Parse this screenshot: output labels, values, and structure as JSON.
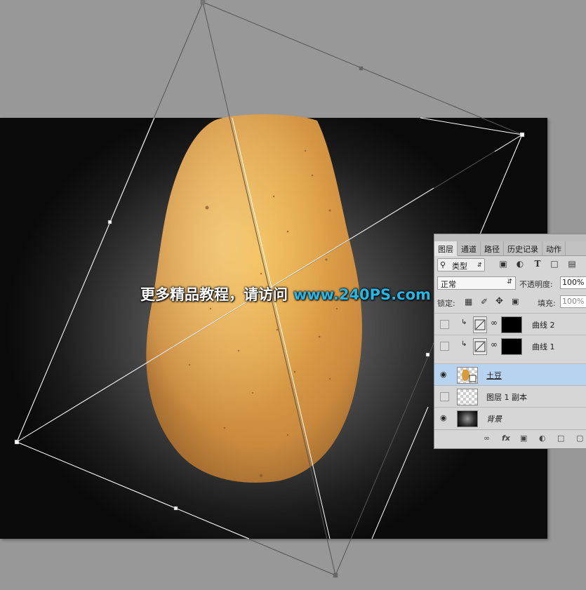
{
  "watermark": {
    "text_cn": "更多精品教程，请访问",
    "url": "www.240PS.com",
    "url_color": "#22b8e8"
  },
  "layers_panel": {
    "tabs": [
      {
        "label": "图层",
        "active": true
      },
      {
        "label": "通道",
        "active": false
      },
      {
        "label": "路径",
        "active": false
      },
      {
        "label": "历史记录",
        "active": false
      },
      {
        "label": "动作",
        "active": false
      }
    ],
    "filter": {
      "label": "类型",
      "icons": [
        "image-filter-icon",
        "adjustment-filter-icon",
        "type-filter-icon",
        "shape-filter-icon",
        "smart-object-filter-icon"
      ]
    },
    "blend_mode": "正常",
    "opacity_label": "不透明度:",
    "opacity_value": "100%",
    "lock_label": "锁定:",
    "fill_label": "填充:",
    "fill_value": "100%",
    "layers": [
      {
        "name": "曲线 2",
        "visible": false,
        "type": "curves-adjustment",
        "clipped": true,
        "selected": false
      },
      {
        "name": "曲线 1",
        "visible": false,
        "type": "curves-adjustment",
        "clipped": true,
        "selected": false
      },
      {
        "name": "土豆",
        "visible": true,
        "type": "smart-object",
        "clipped": false,
        "selected": true
      },
      {
        "name": "图层 1 副本",
        "visible": false,
        "type": "pixel-transparent",
        "clipped": false,
        "selected": false
      },
      {
        "name": "背景",
        "visible": true,
        "type": "background",
        "clipped": false,
        "selected": false
      }
    ]
  }
}
